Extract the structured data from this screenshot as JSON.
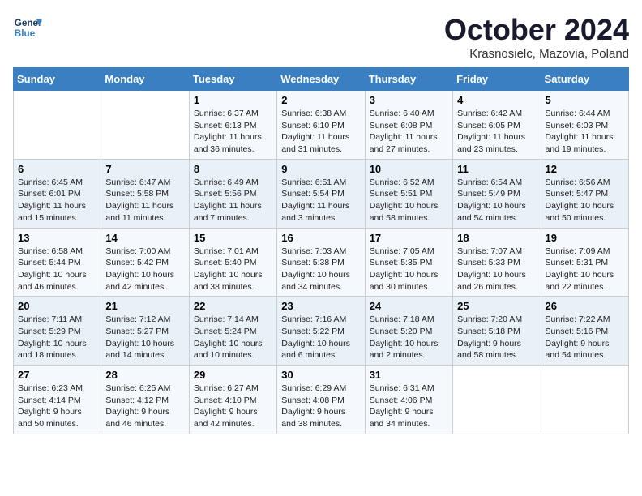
{
  "header": {
    "logo_line1": "General",
    "logo_line2": "Blue",
    "month_title": "October 2024",
    "location": "Krasnosielc, Mazovia, Poland"
  },
  "days_of_week": [
    "Sunday",
    "Monday",
    "Tuesday",
    "Wednesday",
    "Thursday",
    "Friday",
    "Saturday"
  ],
  "weeks": [
    [
      {
        "num": "",
        "sunrise": "",
        "sunset": "",
        "daylight": ""
      },
      {
        "num": "",
        "sunrise": "",
        "sunset": "",
        "daylight": ""
      },
      {
        "num": "1",
        "sunrise": "Sunrise: 6:37 AM",
        "sunset": "Sunset: 6:13 PM",
        "daylight": "Daylight: 11 hours and 36 minutes."
      },
      {
        "num": "2",
        "sunrise": "Sunrise: 6:38 AM",
        "sunset": "Sunset: 6:10 PM",
        "daylight": "Daylight: 11 hours and 31 minutes."
      },
      {
        "num": "3",
        "sunrise": "Sunrise: 6:40 AM",
        "sunset": "Sunset: 6:08 PM",
        "daylight": "Daylight: 11 hours and 27 minutes."
      },
      {
        "num": "4",
        "sunrise": "Sunrise: 6:42 AM",
        "sunset": "Sunset: 6:05 PM",
        "daylight": "Daylight: 11 hours and 23 minutes."
      },
      {
        "num": "5",
        "sunrise": "Sunrise: 6:44 AM",
        "sunset": "Sunset: 6:03 PM",
        "daylight": "Daylight: 11 hours and 19 minutes."
      }
    ],
    [
      {
        "num": "6",
        "sunrise": "Sunrise: 6:45 AM",
        "sunset": "Sunset: 6:01 PM",
        "daylight": "Daylight: 11 hours and 15 minutes."
      },
      {
        "num": "7",
        "sunrise": "Sunrise: 6:47 AM",
        "sunset": "Sunset: 5:58 PM",
        "daylight": "Daylight: 11 hours and 11 minutes."
      },
      {
        "num": "8",
        "sunrise": "Sunrise: 6:49 AM",
        "sunset": "Sunset: 5:56 PM",
        "daylight": "Daylight: 11 hours and 7 minutes."
      },
      {
        "num": "9",
        "sunrise": "Sunrise: 6:51 AM",
        "sunset": "Sunset: 5:54 PM",
        "daylight": "Daylight: 11 hours and 3 minutes."
      },
      {
        "num": "10",
        "sunrise": "Sunrise: 6:52 AM",
        "sunset": "Sunset: 5:51 PM",
        "daylight": "Daylight: 10 hours and 58 minutes."
      },
      {
        "num": "11",
        "sunrise": "Sunrise: 6:54 AM",
        "sunset": "Sunset: 5:49 PM",
        "daylight": "Daylight: 10 hours and 54 minutes."
      },
      {
        "num": "12",
        "sunrise": "Sunrise: 6:56 AM",
        "sunset": "Sunset: 5:47 PM",
        "daylight": "Daylight: 10 hours and 50 minutes."
      }
    ],
    [
      {
        "num": "13",
        "sunrise": "Sunrise: 6:58 AM",
        "sunset": "Sunset: 5:44 PM",
        "daylight": "Daylight: 10 hours and 46 minutes."
      },
      {
        "num": "14",
        "sunrise": "Sunrise: 7:00 AM",
        "sunset": "Sunset: 5:42 PM",
        "daylight": "Daylight: 10 hours and 42 minutes."
      },
      {
        "num": "15",
        "sunrise": "Sunrise: 7:01 AM",
        "sunset": "Sunset: 5:40 PM",
        "daylight": "Daylight: 10 hours and 38 minutes."
      },
      {
        "num": "16",
        "sunrise": "Sunrise: 7:03 AM",
        "sunset": "Sunset: 5:38 PM",
        "daylight": "Daylight: 10 hours and 34 minutes."
      },
      {
        "num": "17",
        "sunrise": "Sunrise: 7:05 AM",
        "sunset": "Sunset: 5:35 PM",
        "daylight": "Daylight: 10 hours and 30 minutes."
      },
      {
        "num": "18",
        "sunrise": "Sunrise: 7:07 AM",
        "sunset": "Sunset: 5:33 PM",
        "daylight": "Daylight: 10 hours and 26 minutes."
      },
      {
        "num": "19",
        "sunrise": "Sunrise: 7:09 AM",
        "sunset": "Sunset: 5:31 PM",
        "daylight": "Daylight: 10 hours and 22 minutes."
      }
    ],
    [
      {
        "num": "20",
        "sunrise": "Sunrise: 7:11 AM",
        "sunset": "Sunset: 5:29 PM",
        "daylight": "Daylight: 10 hours and 18 minutes."
      },
      {
        "num": "21",
        "sunrise": "Sunrise: 7:12 AM",
        "sunset": "Sunset: 5:27 PM",
        "daylight": "Daylight: 10 hours and 14 minutes."
      },
      {
        "num": "22",
        "sunrise": "Sunrise: 7:14 AM",
        "sunset": "Sunset: 5:24 PM",
        "daylight": "Daylight: 10 hours and 10 minutes."
      },
      {
        "num": "23",
        "sunrise": "Sunrise: 7:16 AM",
        "sunset": "Sunset: 5:22 PM",
        "daylight": "Daylight: 10 hours and 6 minutes."
      },
      {
        "num": "24",
        "sunrise": "Sunrise: 7:18 AM",
        "sunset": "Sunset: 5:20 PM",
        "daylight": "Daylight: 10 hours and 2 minutes."
      },
      {
        "num": "25",
        "sunrise": "Sunrise: 7:20 AM",
        "sunset": "Sunset: 5:18 PM",
        "daylight": "Daylight: 9 hours and 58 minutes."
      },
      {
        "num": "26",
        "sunrise": "Sunrise: 7:22 AM",
        "sunset": "Sunset: 5:16 PM",
        "daylight": "Daylight: 9 hours and 54 minutes."
      }
    ],
    [
      {
        "num": "27",
        "sunrise": "Sunrise: 6:23 AM",
        "sunset": "Sunset: 4:14 PM",
        "daylight": "Daylight: 9 hours and 50 minutes."
      },
      {
        "num": "28",
        "sunrise": "Sunrise: 6:25 AM",
        "sunset": "Sunset: 4:12 PM",
        "daylight": "Daylight: 9 hours and 46 minutes."
      },
      {
        "num": "29",
        "sunrise": "Sunrise: 6:27 AM",
        "sunset": "Sunset: 4:10 PM",
        "daylight": "Daylight: 9 hours and 42 minutes."
      },
      {
        "num": "30",
        "sunrise": "Sunrise: 6:29 AM",
        "sunset": "Sunset: 4:08 PM",
        "daylight": "Daylight: 9 hours and 38 minutes."
      },
      {
        "num": "31",
        "sunrise": "Sunrise: 6:31 AM",
        "sunset": "Sunset: 4:06 PM",
        "daylight": "Daylight: 9 hours and 34 minutes."
      },
      {
        "num": "",
        "sunrise": "",
        "sunset": "",
        "daylight": ""
      },
      {
        "num": "",
        "sunrise": "",
        "sunset": "",
        "daylight": ""
      }
    ]
  ]
}
